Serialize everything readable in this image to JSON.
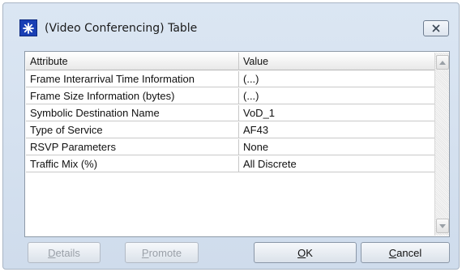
{
  "window": {
    "title": "(Video Conferencing) Table",
    "icon": "star-asterisk-icon",
    "close_icon": "close-icon"
  },
  "table": {
    "columns": [
      "Attribute",
      "Value"
    ],
    "rows": [
      {
        "attribute": "Frame Interarrival Time Information",
        "value": "(...)"
      },
      {
        "attribute": "Frame Size Information (bytes)",
        "value": "(...)"
      },
      {
        "attribute": "Symbolic Destination Name",
        "value": "VoD_1"
      },
      {
        "attribute": "Type of Service",
        "value": "AF43"
      },
      {
        "attribute": "RSVP Parameters",
        "value": "None"
      },
      {
        "attribute": "Traffic Mix (%)",
        "value": "All Discrete"
      }
    ]
  },
  "buttons": {
    "details": {
      "mnemonic": "D",
      "rest": "etails",
      "enabled": false
    },
    "promote": {
      "mnemonic": "P",
      "rest": "romote",
      "enabled": false
    },
    "ok": {
      "mnemonic": "O",
      "rest": "K",
      "enabled": true
    },
    "cancel": {
      "mnemonic": "C",
      "rest": "ancel",
      "enabled": true
    }
  },
  "colors": {
    "frame": "#cfdcec",
    "icon_bg": "#1a3fb4"
  }
}
